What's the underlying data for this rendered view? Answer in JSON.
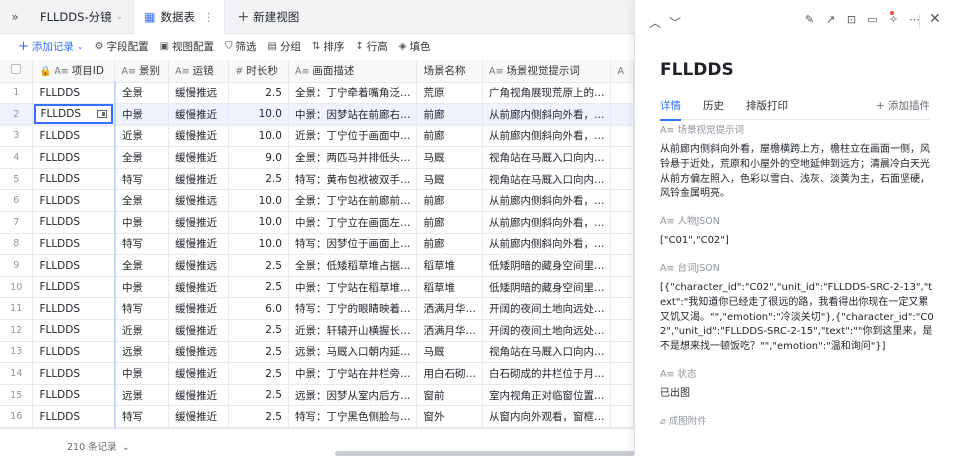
{
  "topbar": {
    "collapse_icon": "double-chevron-right",
    "base_tab": "FLLDDS-分镜",
    "active_tab": "数据表",
    "new_view": "新建视图"
  },
  "toolbar": {
    "add_record": "添加记录",
    "field_config": "字段配置",
    "view_config": "视图配置",
    "filter": "筛选",
    "group": "分组",
    "sort": "排序",
    "row_height": "行高",
    "fill": "填色"
  },
  "columns": [
    "项目ID",
    "景别",
    "运镜",
    "时长秒",
    "画面描述",
    "场景名称",
    "场景视觉提示词"
  ],
  "rows": [
    {
      "n": "1",
      "pid": "FLLDDS",
      "shot": "全景",
      "cam": "缓慢推远",
      "dur": "2.5",
      "desc": "全景：丁宁牵着嘴角泛…",
      "scene": "荒原",
      "prompt": "广角视角展现荒原上的…"
    },
    {
      "n": "2",
      "pid": "FLLDDS",
      "shot": "中景",
      "cam": "缓慢推近",
      "dur": "10.0",
      "desc": "中景：因梦站在前廊右…",
      "scene": "前廊",
      "prompt": "从前廊内侧斜向外看，…"
    },
    {
      "n": "3",
      "pid": "FLLDDS",
      "shot": "近景",
      "cam": "缓慢推近",
      "dur": "10.0",
      "desc": "近景：丁宁位于画面中…",
      "scene": "前廊",
      "prompt": "从前廊内侧斜向外看，…"
    },
    {
      "n": "4",
      "pid": "FLLDDS",
      "shot": "全景",
      "cam": "缓慢推近",
      "dur": "9.0",
      "desc": "全景：两匹马并排低头…",
      "scene": "马厩",
      "prompt": "视角站在马厩入口向内…"
    },
    {
      "n": "5",
      "pid": "FLLDDS",
      "shot": "特写",
      "cam": "缓慢推近",
      "dur": "2.5",
      "desc": "特写：黄布包袱被双手…",
      "scene": "马厩",
      "prompt": "视角站在马厩入口向内…"
    },
    {
      "n": "6",
      "pid": "FLLDDS",
      "shot": "全景",
      "cam": "缓慢推远",
      "dur": "10.0",
      "desc": "全景：丁宁站在前廊前…",
      "scene": "前廊",
      "prompt": "从前廊内侧斜向外看，…"
    },
    {
      "n": "7",
      "pid": "FLLDDS",
      "shot": "中景",
      "cam": "缓慢推近",
      "dur": "10.0",
      "desc": "中景：丁宁立在画面左…",
      "scene": "前廊",
      "prompt": "从前廊内侧斜向外看，…"
    },
    {
      "n": "8",
      "pid": "FLLDDS",
      "shot": "特写",
      "cam": "缓慢推近",
      "dur": "10.0",
      "desc": "特写：因梦位于画面上…",
      "scene": "前廊",
      "prompt": "从前廊内侧斜向外看，…"
    },
    {
      "n": "9",
      "pid": "FLLDDS",
      "shot": "全景",
      "cam": "缓慢推远",
      "dur": "2.5",
      "desc": "全景：低矮稻草堆占据…",
      "scene": "稻草堆",
      "prompt": "低矮阴暗的藏身空间里…"
    },
    {
      "n": "10",
      "pid": "FLLDDS",
      "shot": "中景",
      "cam": "缓慢推近",
      "dur": "2.5",
      "desc": "中景：丁宁站在稻草堆…",
      "scene": "稻草堆",
      "prompt": "低矮阴暗的藏身空间里…"
    },
    {
      "n": "11",
      "pid": "FLLDDS",
      "shot": "特写",
      "cam": "缓慢推近",
      "dur": "6.0",
      "desc": "特写：丁宁的眼睛映着…",
      "scene": "洒满月华…",
      "prompt": "开阔的夜间土地向远处…"
    },
    {
      "n": "12",
      "pid": "FLLDDS",
      "shot": "近景",
      "cam": "缓慢推近",
      "dur": "2.5",
      "desc": "近景：轩辕开山横握长…",
      "scene": "洒满月华…",
      "prompt": "开阔的夜间土地向远处…"
    },
    {
      "n": "13",
      "pid": "FLLDDS",
      "shot": "远景",
      "cam": "缓慢推远",
      "dur": "2.5",
      "desc": "远景：马厩入口朝内延…",
      "scene": "马厩",
      "prompt": "视角站在马厩入口向内…"
    },
    {
      "n": "14",
      "pid": "FLLDDS",
      "shot": "中景",
      "cam": "缓慢推近",
      "dur": "2.5",
      "desc": "中景：丁宁站在井栏旁…",
      "scene": "用白石砌…",
      "prompt": "白石砌成的井栏位于月…"
    },
    {
      "n": "15",
      "pid": "FLLDDS",
      "shot": "远景",
      "cam": "缓慢推近",
      "dur": "2.5",
      "desc": "远景：因梦从室内后方…",
      "scene": "窗前",
      "prompt": "室内视角正对临窗位置…"
    },
    {
      "n": "16",
      "pid": "FLLDDS",
      "shot": "特写",
      "cam": "缓慢推近",
      "dur": "2.5",
      "desc": "特写：丁宁黑色侧脸与…",
      "scene": "窗外",
      "prompt": "从窗内向外观看，窗框…"
    },
    {
      "n": "17",
      "pid": "",
      "shot": "",
      "cam": "",
      "dur": "",
      "desc": "",
      "scene": "",
      "prompt": ""
    }
  ],
  "footer": {
    "record_count": "210 条记录"
  },
  "panel": {
    "title": "FLLDDS",
    "tabs": [
      "详情",
      "历史",
      "排版打印"
    ],
    "add_plugin": "添加插件",
    "fields": {
      "prompt_label": "场景视觉提示词",
      "prompt_value": "从前廊内侧斜向外看，屋檐横跨上方，檐柱立在画面一侧，风铃悬于近处，荒原和小屋外的空地延伸到远方；清晨冷白天光从前方偏左照入，色彩以雪白、浅灰、淡黄为主，石面坚硬，风铃金属明亮。",
      "chars_label": "人物JSON",
      "chars_value": "[\"C01\",\"C02\"]",
      "lines_label": "台词JSON",
      "lines_value": "[{\"character_id\":\"C02\",\"unit_id\":\"FLLDDS-SRC-2-13\",\"text\":\"我知道你已经走了很远的路，我看得出你现在一定又累又饥又渴。\"\",\"emotion\":\"冷淡关切\"},{\"character_id\":\"C02\",\"unit_id\":\"FLLDDS-SRC-2-15\",\"text\":\"\"你到这里来，是不是想来找一顿饭吃？\"\",\"emotion\":\"温和询问\"}]",
      "status_label": "状态",
      "status_value": "已出图",
      "attach_label": "成图附件"
    }
  }
}
